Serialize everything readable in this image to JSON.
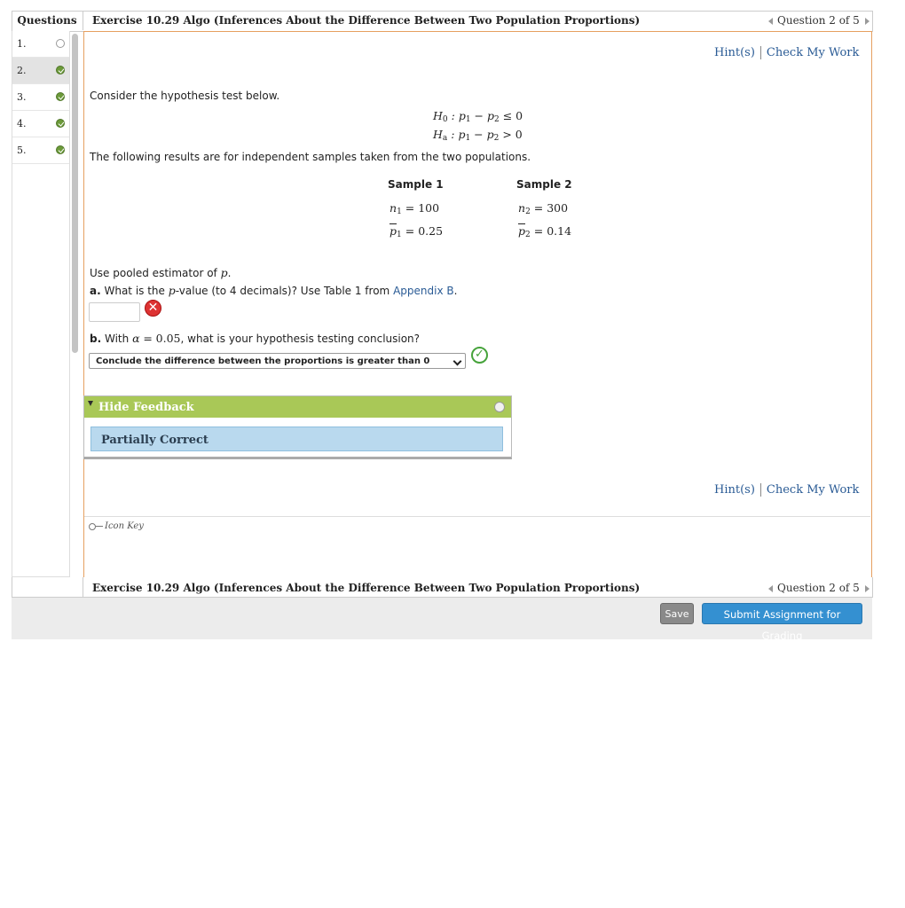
{
  "header": {
    "questions_label": "Questions",
    "exercise_title": "Exercise 10.29 Algo (Inferences About the Difference Between Two Population Proportions)",
    "question_nav": "Question 2 of 5"
  },
  "sidebar": {
    "items": [
      {
        "number": "1.",
        "status": "unanswered"
      },
      {
        "number": "2.",
        "status": "answered"
      },
      {
        "number": "3.",
        "status": "answered"
      },
      {
        "number": "4.",
        "status": "answered"
      },
      {
        "number": "5.",
        "status": "answered"
      }
    ]
  },
  "toolbar": {
    "hint_label": "Hint(s)",
    "check_label": "Check My Work"
  },
  "problem": {
    "intro": "Consider the hypothesis test below.",
    "h0_label": "H",
    "h0_sub": "0",
    "h0_expr": "p",
    "ha_label": "H",
    "ha_sub": "a",
    "results_text": "The following results are for independent samples taken from the two populations.",
    "sample1_header": "Sample 1",
    "sample2_header": "Sample 2",
    "n1_value": "100",
    "n2_value": "300",
    "p1_value": "0.25",
    "p2_value": "0.14",
    "pooled_text": "Use pooled estimator of",
    "part_a_label": "a.",
    "part_a_text_1": "What is the",
    "part_a_text_2": "-value (to 4 decimals)? Use Table 1 from",
    "appendix_link": "Appendix B",
    "part_a_value": "",
    "part_b_label": "b.",
    "part_b_text_1": "With",
    "part_b_alpha": "0.05",
    "part_b_text_2": ", what is your hypothesis testing conclusion?",
    "part_b_selected": "Conclude the difference between the proportions is greater than 0"
  },
  "feedback": {
    "toggle_label": "Hide Feedback",
    "status": "Partially Correct"
  },
  "icon_key_label": "Icon Key",
  "footer": {
    "save_label": "Save",
    "submit_label": "Submit Assignment for Grading"
  },
  "colors": {
    "accent": "#2a5b95",
    "feedback_header": "#a9c857",
    "feedback_body": "#b9d9ee",
    "panel_border": "#e6a060",
    "submit_button": "#3490d1"
  }
}
